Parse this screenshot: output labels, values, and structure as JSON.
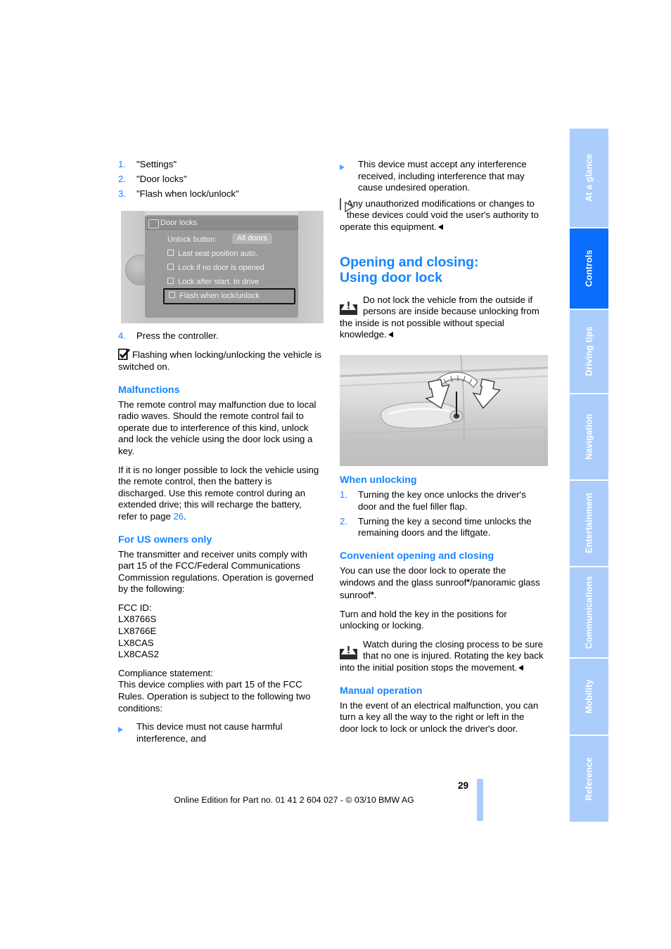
{
  "page": {
    "number": "29",
    "footer": "Online Edition for Part no. 01 41 2 604 027 - © 03/10 BMW AG"
  },
  "left_column": {
    "steps_top": [
      {
        "num": "1.",
        "text": "\"Settings\""
      },
      {
        "num": "2.",
        "text": "\"Door locks\""
      },
      {
        "num": "3.",
        "text": "\"Flash when lock/unlock\""
      }
    ],
    "figure_idrive": {
      "title": "Door locks",
      "value_label": "Unlock button:",
      "value": "All doors",
      "options": [
        "Last seat position auto.",
        "Lock if no door is opened",
        "Lock after start. to drive",
        "Flash when lock/unlock"
      ],
      "highlighted_option": "Flash when lock/unlock"
    },
    "step_four": {
      "num": "4.",
      "text": "Press the controller."
    },
    "note_flashing": "Flashing when locking/unlocking the vehicle is switched on.",
    "malfunctions": {
      "heading": "Malfunctions",
      "para1": "The remote control may malfunction due to local radio waves. Should the remote control fail to operate due to interference of this kind, unlock and lock the vehicle using the door lock using a key.",
      "para2_a": "If it is no longer possible to lock the vehicle using the remote control, then the battery is discharged. Use this remote control during an extended drive; this will recharge the battery, refer to page ",
      "para2_page_ref": "26",
      "para2_b": "."
    },
    "us_owners": {
      "heading": "For US owners only",
      "para1": "The transmitter and receiver units comply with part 15 of the FCC/Federal Communications Commission regulations. Operation is governed by the following:",
      "fcc_label": "FCC ID:",
      "fcc_ids": [
        "LX8766S",
        "LX8766E",
        "LX8CAS",
        "LX8CAS2"
      ],
      "compliance_label": "Compliance statement:",
      "compliance_text": "This device complies with part 15 of the FCC Rules. Operation is subject to the following two conditions:",
      "condition1": "This device must not cause harmful interference, and"
    }
  },
  "right_column": {
    "condition2": "This device must accept any interference received, including interference that may cause undesired operation.",
    "note_modifications": "Any unauthorized modifications or changes to these devices could void the user's authority to operate this equipment.",
    "section_title_line1": "Opening and closing:",
    "section_title_line2": "Using door lock",
    "warning_do_not_lock": "Do not lock the vehicle from the outside if persons are inside because unlocking from the inside is not possible without special knowledge.",
    "figure_door_watermark": "WKS1IX010001",
    "when_unlocking": {
      "heading": "When unlocking",
      "steps": [
        {
          "num": "1.",
          "text": "Turning the key once unlocks the driver's door and the fuel filler flap."
        },
        {
          "num": "2.",
          "text": "Turning the key a second time unlocks the remaining doors and the liftgate."
        }
      ]
    },
    "convenient": {
      "heading": "Convenient opening and closing",
      "para1_a": "You can use the door lock to operate the windows and the glass sunroof",
      "para1_b": "/panoramic glass sunroof",
      "para1_c": ".",
      "star": "*",
      "para2": "Turn and hold the key in the positions for unlocking or locking.",
      "warning": "Watch during the closing process to be sure that no one is injured. Rotating the key back into the initial position stops the movement."
    },
    "manual_operation": {
      "heading": "Manual operation",
      "para1": "In the event of an electrical malfunction, you can turn a key all the way to the right or left in the door lock to lock or unlock the driver's door."
    }
  },
  "rail": {
    "tabs": [
      {
        "label": "At a glance",
        "active": false
      },
      {
        "label": "Controls",
        "active": true
      },
      {
        "label": "Driving tips",
        "active": false
      },
      {
        "label": "Navigation",
        "active": false
      },
      {
        "label": "Entertainment",
        "active": false
      },
      {
        "label": "Communications",
        "active": false
      },
      {
        "label": "Mobility",
        "active": false
      },
      {
        "label": "Reference",
        "active": false
      }
    ]
  },
  "colors": {
    "accent_blue": "#1485ff",
    "tab_inactive": "#aacdfb",
    "tab_active": "#0a6dfb"
  }
}
